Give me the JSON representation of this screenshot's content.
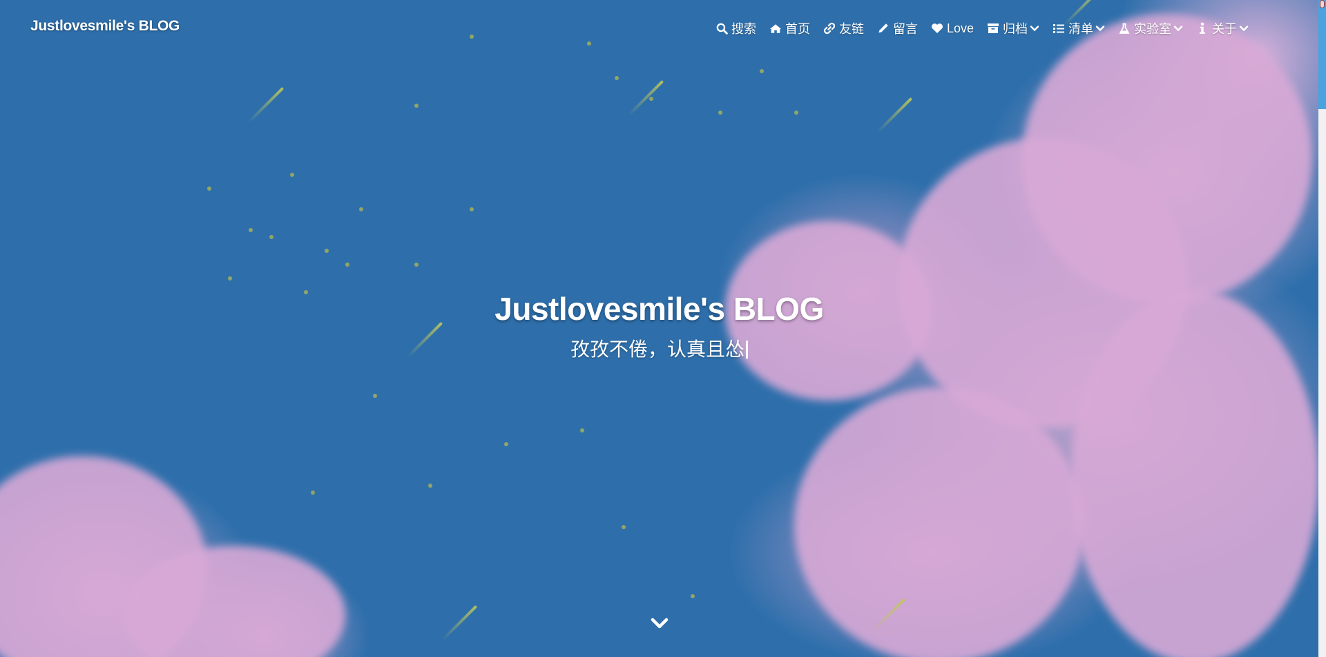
{
  "navbar": {
    "brand": "Justlovesmile's BLOG",
    "items": [
      {
        "label": "搜索",
        "icon": "search-icon",
        "has_dropdown": false
      },
      {
        "label": "首页",
        "icon": "home-icon",
        "has_dropdown": false
      },
      {
        "label": "友链",
        "icon": "link-icon",
        "has_dropdown": false
      },
      {
        "label": "留言",
        "icon": "pencil-icon",
        "has_dropdown": false
      },
      {
        "label": "Love",
        "icon": "heart-icon",
        "has_dropdown": false
      },
      {
        "label": "归档",
        "icon": "archive-icon",
        "has_dropdown": true
      },
      {
        "label": "清单",
        "icon": "list-icon",
        "has_dropdown": true
      },
      {
        "label": "实验室",
        "icon": "flask-icon",
        "has_dropdown": true
      },
      {
        "label": "关于",
        "icon": "info-icon",
        "has_dropdown": true
      }
    ]
  },
  "hero": {
    "title": "Justlovesmile's BLOG",
    "subtitle": "孜孜不倦，认真且怂",
    "scroll_icon": "chevron-down-icon"
  },
  "colors": {
    "sky": "#2e6fab",
    "cloud": "#d8a9d6",
    "speck": "#a9b455",
    "scroll_thumb": "#4aa3e0"
  }
}
